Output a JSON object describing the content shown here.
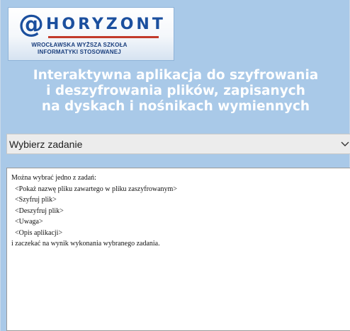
{
  "logo": {
    "at_symbol": "@",
    "name": "HORYZONT",
    "subtitle_line1": "WROCŁAWSKA WYŻSZA SZKOŁA",
    "subtitle_line2": "INFORMATYKI STOSOWANEJ"
  },
  "title": "Interaktywna aplikacja do szyfrowania\ni deszyfrowania plików, zapisanych\nna dyskach i nośnikach wymiennych",
  "task_select": {
    "value": "Wybierz zadanie",
    "icon": "chevron-down-icon"
  },
  "info_text": {
    "lines": [
      "Można wybrać jedno z zadań:",
      "  <Pokaż nazwę pliku zawartego w pliku zaszyfrowanym>",
      "  <Szyfruj plik>",
      "  <Deszyfruj plik>",
      "  <Uwaga>",
      "  <Opis aplikacji>",
      "i zaczekać na wynik wykonania wybranego zadania."
    ]
  },
  "colors": {
    "window_background": "#a9c9e8",
    "logo_blue": "#1b4f9e",
    "logo_accent_red": "#c23a2b",
    "title_text": "#ffffff"
  }
}
